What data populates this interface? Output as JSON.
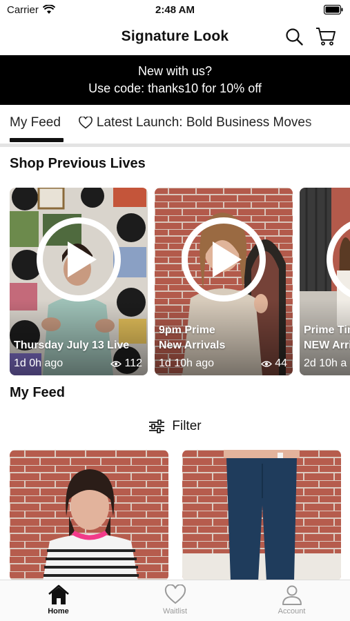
{
  "status_bar": {
    "carrier": "Carrier",
    "time": "2:48 AM"
  },
  "header": {
    "title": "Signature Look"
  },
  "promo": {
    "line1": "New with us?",
    "line2": "Use code: thanks10 for 10% off"
  },
  "tabs": [
    {
      "label": "My Feed",
      "active": true
    },
    {
      "label": "Latest Launch: Bold Business Moves",
      "icon": "heart-outline-icon"
    }
  ],
  "shop_section": {
    "title": "Shop Previous Lives"
  },
  "lives": [
    {
      "title": "Thursday July 13 Live",
      "time": "1d 0h ago",
      "views": "112"
    },
    {
      "title_line1": "9pm Prime",
      "title_line2": "New Arrivals",
      "time": "1d 10h ago",
      "views": "44"
    },
    {
      "title_line1": "Prime Tim",
      "title_line2": "NEW Arri",
      "time": "2d 10h a"
    }
  ],
  "feed_section": {
    "title": "My Feed",
    "filter_label": "Filter"
  },
  "bottom_tabs": [
    {
      "label": "Home",
      "icon": "home-icon",
      "active": true
    },
    {
      "label": "Waitlist",
      "icon": "heart-icon"
    },
    {
      "label": "Account",
      "icon": "person-icon"
    }
  ],
  "colors": {
    "promo_bg": "#000000",
    "brick": "#b0574a",
    "text": "#111111",
    "inactive_tab": "#9a9a9a"
  }
}
